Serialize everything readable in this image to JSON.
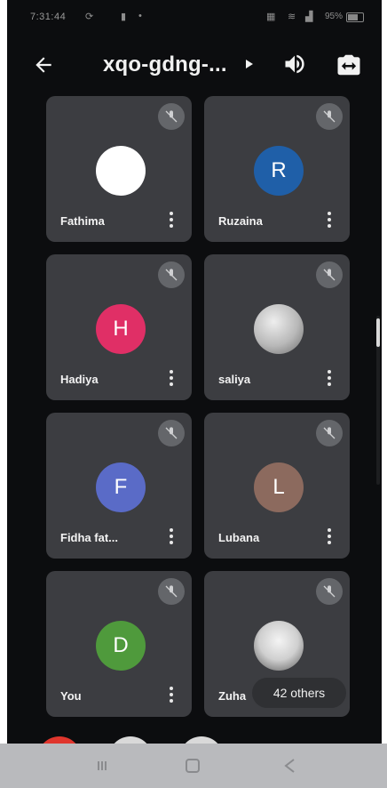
{
  "statusbar": {
    "time": "7:31:44",
    "battery": "95%"
  },
  "topbar": {
    "title": "xqo-gdng-..."
  },
  "participants": [
    {
      "name": "Fathima",
      "initial": "",
      "avatar_color": "#ffffff"
    },
    {
      "name": "Ruzaina",
      "initial": "R",
      "avatar_color": "#1f5fa8"
    },
    {
      "name": "Hadiya",
      "initial": "H",
      "avatar_color": "#e02f66"
    },
    {
      "name": "saliya",
      "initial": "",
      "avatar_color": "#c7c7c7"
    },
    {
      "name": "Fidha fat...",
      "initial": "F",
      "avatar_color": "#5a6bc7"
    },
    {
      "name": "Lubana",
      "initial": "L",
      "avatar_color": "#8c6a5e"
    },
    {
      "name": "You",
      "initial": "D",
      "avatar_color": "#4f9a3c"
    },
    {
      "name": "Zuha",
      "initial": "",
      "avatar_color": "#d8d8d8"
    }
  ],
  "others_chip": "42 others",
  "colors": {
    "background": "#0c0d0f",
    "tile": "#3c3d41",
    "navbar": "#b9babd"
  }
}
